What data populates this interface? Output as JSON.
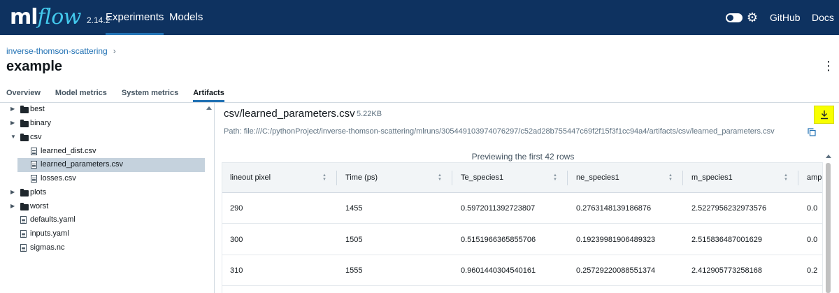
{
  "nav": {
    "logo_ml": "ml",
    "logo_flow": "flow",
    "version": "2.14.2",
    "experiments": "Experiments",
    "models": "Models",
    "github": "GitHub",
    "docs": "Docs",
    "brand_color": "#0e3260",
    "accent_color": "#43c9ed"
  },
  "header": {
    "breadcrumb": "inverse-thomson-scattering",
    "breadcrumb_sep": "›",
    "title": "example"
  },
  "tabs": [
    {
      "label": "Overview"
    },
    {
      "label": "Model metrics"
    },
    {
      "label": "System metrics"
    },
    {
      "label": "Artifacts"
    }
  ],
  "tree": [
    {
      "label": "best",
      "type": "folder",
      "expanded": false,
      "depth": 0
    },
    {
      "label": "binary",
      "type": "folder",
      "expanded": false,
      "depth": 0
    },
    {
      "label": "csv",
      "type": "folder",
      "expanded": true,
      "depth": 0
    },
    {
      "label": "learned_dist.csv",
      "type": "file",
      "depth": 1
    },
    {
      "label": "learned_parameters.csv",
      "type": "file",
      "depth": 1,
      "selected": true
    },
    {
      "label": "losses.csv",
      "type": "file",
      "depth": 1
    },
    {
      "label": "plots",
      "type": "folder",
      "expanded": false,
      "depth": 0
    },
    {
      "label": "worst",
      "type": "folder",
      "expanded": false,
      "depth": 0
    },
    {
      "label": "defaults.yaml",
      "type": "file",
      "depth": 0
    },
    {
      "label": "inputs.yaml",
      "type": "file",
      "depth": 0
    },
    {
      "label": "sigmas.nc",
      "type": "file",
      "depth": 0
    }
  ],
  "artifact": {
    "name": "csv/learned_parameters.csv",
    "size": "5.22KB",
    "path": "Path: file:///C:/pythonProject/inverse-thomson-scattering/mlruns/305449103974076297/c52ad28b755447c69f2f15f3f1cc94a4/artifacts/csv/learned_parameters.csv",
    "preview_note": "Previewing the first 42 rows",
    "download_highlight": "#f8ff00"
  },
  "table": {
    "columns": [
      "lineout pixel",
      "Time (ps)",
      "Te_species1",
      "ne_species1",
      "m_species1",
      "amp"
    ],
    "rows": [
      [
        "290",
        "1455",
        "0.5972011392723807",
        "0.2763148139186876",
        "2.5227956232973576",
        "0.0"
      ],
      [
        "300",
        "1505",
        "0.5151966365855706",
        "0.19239981906489323",
        "2.515836487001629",
        "0.0"
      ],
      [
        "310",
        "1555",
        "0.9601440304540161",
        "0.25729220088551374",
        "2.412905773258168",
        "0.2"
      ]
    ]
  }
}
